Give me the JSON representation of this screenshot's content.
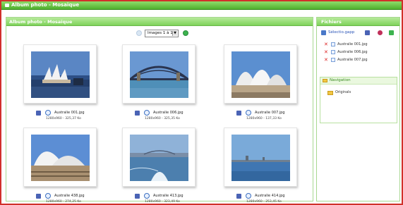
{
  "window": {
    "title": "Album photo - Mosaïque"
  },
  "main": {
    "title": "Album photo - Mosaïque",
    "pager": {
      "selected": "Images 1 à 15"
    }
  },
  "photos": [
    {
      "name": "Australie 001.jpg",
      "size": "1280x960 - 325,37 Ko"
    },
    {
      "name": "Australie 006.jpg",
      "size": "1280x960 - 325,35 Ko"
    },
    {
      "name": "Australie 007.jpg",
      "size": "1280x960 - 137,33 Ko"
    },
    {
      "name": "Australie 438.jpg",
      "size": "1280x960 - 274,25 Ko"
    },
    {
      "name": "Australie 413.jpg",
      "size": "1280x960 - 323,49 Ko"
    },
    {
      "name": "Australie 414.jpg",
      "size": "1280x960 - 253,45 Ko"
    }
  ],
  "sidebar": {
    "title": "Fichiers",
    "toolbar_label": "Sélectio.gapp",
    "files": [
      "Australie 001.jpg",
      "Australie 006.jpg",
      "Australie 007.jpg"
    ],
    "navigation": {
      "title": "Navigation",
      "folder": "Originals"
    }
  },
  "colors": {
    "frame": "#d0302a",
    "header_green": "#6cc84a",
    "accent_blue": "#2b55b8"
  }
}
